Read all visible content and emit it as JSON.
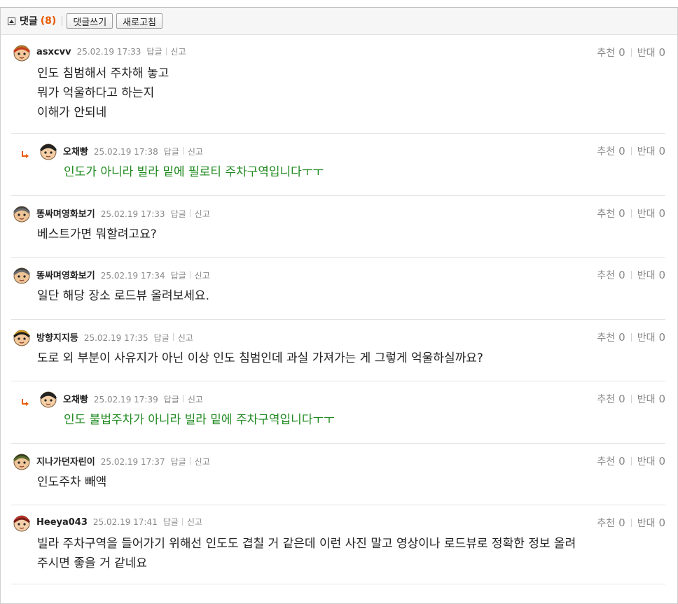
{
  "header": {
    "title": "댓글",
    "count": "(8)",
    "write_label": "댓글쓰기",
    "refresh_label": "새로고침"
  },
  "labels": {
    "reply": "답글",
    "report": "신고",
    "up": "추천",
    "down": "반대"
  },
  "comments": [
    {
      "nick": "asxcvv",
      "date": "25.02.19 17:33",
      "text": "인도 침범해서 주차해 놓고\n뭐가 억울하다고 하는지\n이해가 안되네",
      "up": "0",
      "down": "0",
      "is_reply": false
    },
    {
      "nick": "오채빵",
      "date": "25.02.19 17:38",
      "text": "인도가 아니라 빌라 밑에 필로티 주차구역입니다ㅜㅜ",
      "up": "0",
      "down": "0",
      "is_reply": true
    },
    {
      "nick": "똥싸며영화보기",
      "date": "25.02.19 17:33",
      "text": "베스트가면 뭐할려고요?",
      "up": "0",
      "down": "0",
      "is_reply": false
    },
    {
      "nick": "똥싸며영화보기",
      "date": "25.02.19 17:34",
      "text": "일단 해당 장소 로드뷰 올려보세요.",
      "up": "0",
      "down": "0",
      "is_reply": false
    },
    {
      "nick": "방향지지등",
      "date": "25.02.19 17:35",
      "text": "도로 외 부분이 사유지가 아닌 이상 인도 침범인데 과실 가져가는 게 그렇게 억울하실까요?",
      "up": "0",
      "down": "0",
      "is_reply": false
    },
    {
      "nick": "오채빵",
      "date": "25.02.19 17:39",
      "text": "인도 불법주차가 아니라 빌라 밑에 주차구역입니다ㅜㅜ",
      "up": "0",
      "down": "0",
      "is_reply": true
    },
    {
      "nick": "지나가던자린이",
      "date": "25.02.19 17:37",
      "text": "인도주차 빼액",
      "up": "0",
      "down": "0",
      "is_reply": false
    },
    {
      "nick": "Heeya043",
      "date": "25.02.19 17:41",
      "text": "빌라 주차구역을 들어가기 위해선 인도도 겹칠 거 같은데 이런 사진 말고 영상이나 로드뷰로 정확한 정보 올려\n주시면 좋을 거 같네요",
      "up": "0",
      "down": "0",
      "is_reply": false
    }
  ],
  "colors": {
    "count": "#e85a00",
    "reply_text": "#1f8a1f",
    "reply_arrow": "#e85a00"
  },
  "icons": {
    "toggle": "collapse-toggle-icon",
    "reply_arrow": "reply-arrow-icon",
    "avatar": "avatar-icon"
  }
}
